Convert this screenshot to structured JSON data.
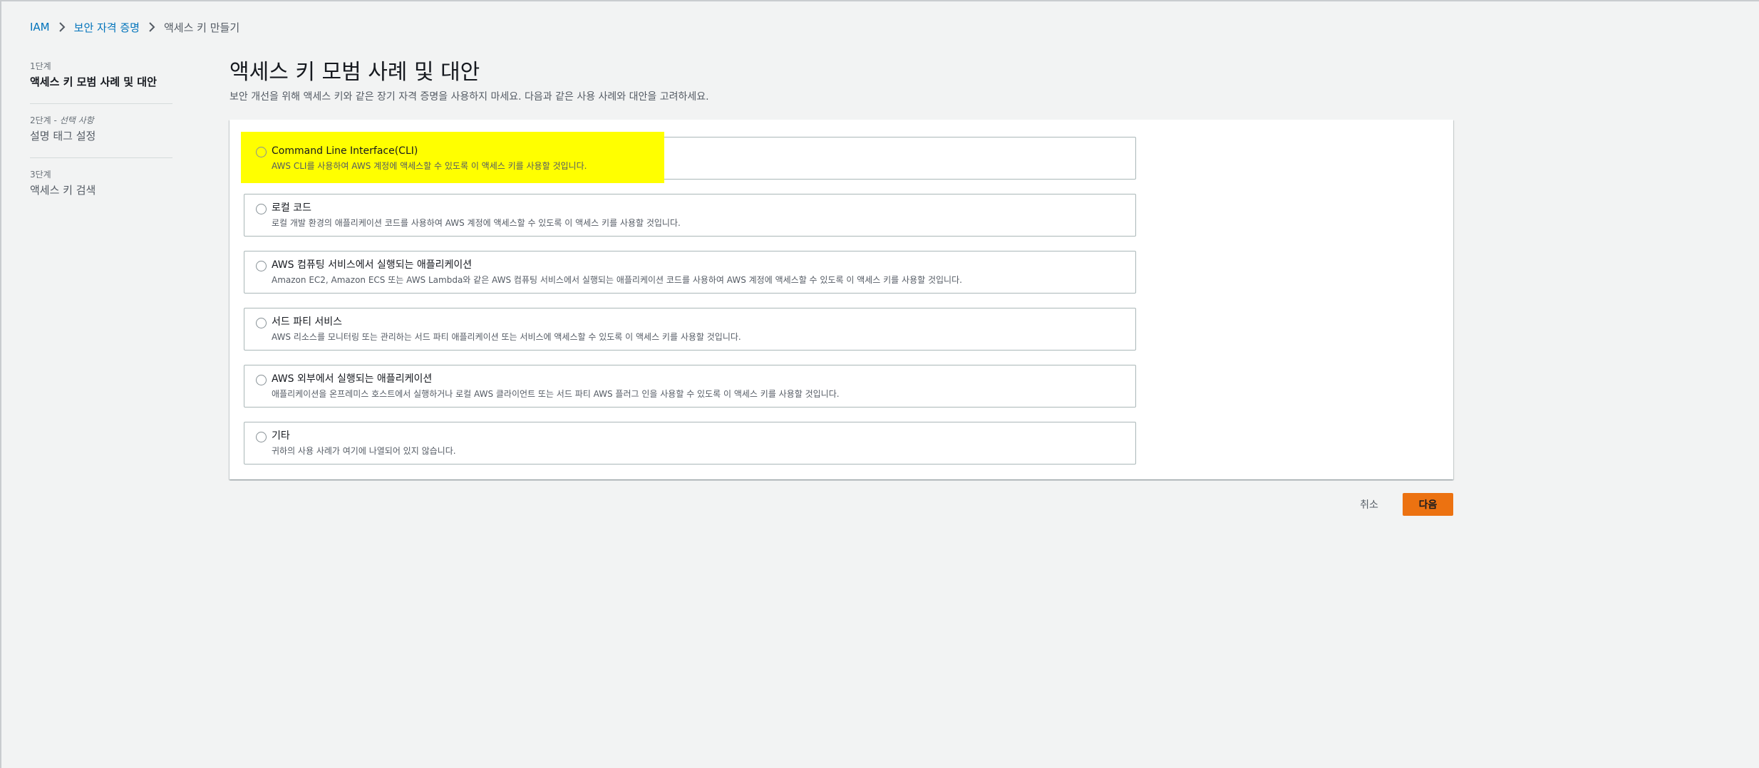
{
  "breadcrumb": {
    "items": [
      "IAM",
      "보안 자격 증명",
      "액세스 키 만들기"
    ]
  },
  "steps": [
    {
      "num": "1단계",
      "optional": "",
      "title": "액세스 키 모범 사례 및 대안",
      "active": true
    },
    {
      "num": "2단계 - ",
      "optional": "선택 사항",
      "title": "설명 태그 설정",
      "active": false
    },
    {
      "num": "3단계",
      "optional": "",
      "title": "액세스 키 검색",
      "active": false
    }
  ],
  "page": {
    "title": "액세스 키 모범 사례 및 대안",
    "description": "보안 개선을 위해 액세스 키와 같은 장기 자격 증명을 사용하지 마세요. 다음과 같은 사용 사례와 대안을 고려하세요."
  },
  "options": [
    {
      "title": "Command Line Interface(CLI)",
      "description": "AWS CLI를 사용하여 AWS 계정에 액세스할 수 있도록 이 액세스 키를 사용할 것입니다."
    },
    {
      "title": "로컬 코드",
      "description": "로컬 개발 환경의 애플리케이션 코드를 사용하여 AWS 계정에 액세스할 수 있도록 이 액세스 키를 사용할 것입니다."
    },
    {
      "title": "AWS 컴퓨팅 서비스에서 실행되는 애플리케이션",
      "description": "Amazon EC2, Amazon ECS 또는 AWS Lambda와 같은 AWS 컴퓨팅 서비스에서 실행되는 애플리케이션 코드를 사용하여 AWS 계정에 액세스할 수 있도록 이 액세스 키를 사용할 것입니다."
    },
    {
      "title": "서드 파티 서비스",
      "description": "AWS 리소스를 모니터링 또는 관리하는 서드 파티 애플리케이션 또는 서비스에 액세스할 수 있도록 이 액세스 키를 사용할 것입니다."
    },
    {
      "title": "AWS 외부에서 실행되는 애플리케이션",
      "description": "애플리케이션을 온프레미스 호스트에서 실행하거나 로컬 AWS 클라이언트 또는 서드 파티 AWS 플러그 인을 사용할 수 있도록 이 액세스 키를 사용할 것입니다."
    },
    {
      "title": "기타",
      "description": "귀하의 사용 사례가 여기에 나열되어 있지 않습니다."
    }
  ],
  "actions": {
    "cancel_label": "취소",
    "next_label": "다음"
  },
  "colors": {
    "link": "#0073bb",
    "primary_button": "#ec7211",
    "highlight": "#ffff00",
    "background": "#f2f3f3"
  }
}
